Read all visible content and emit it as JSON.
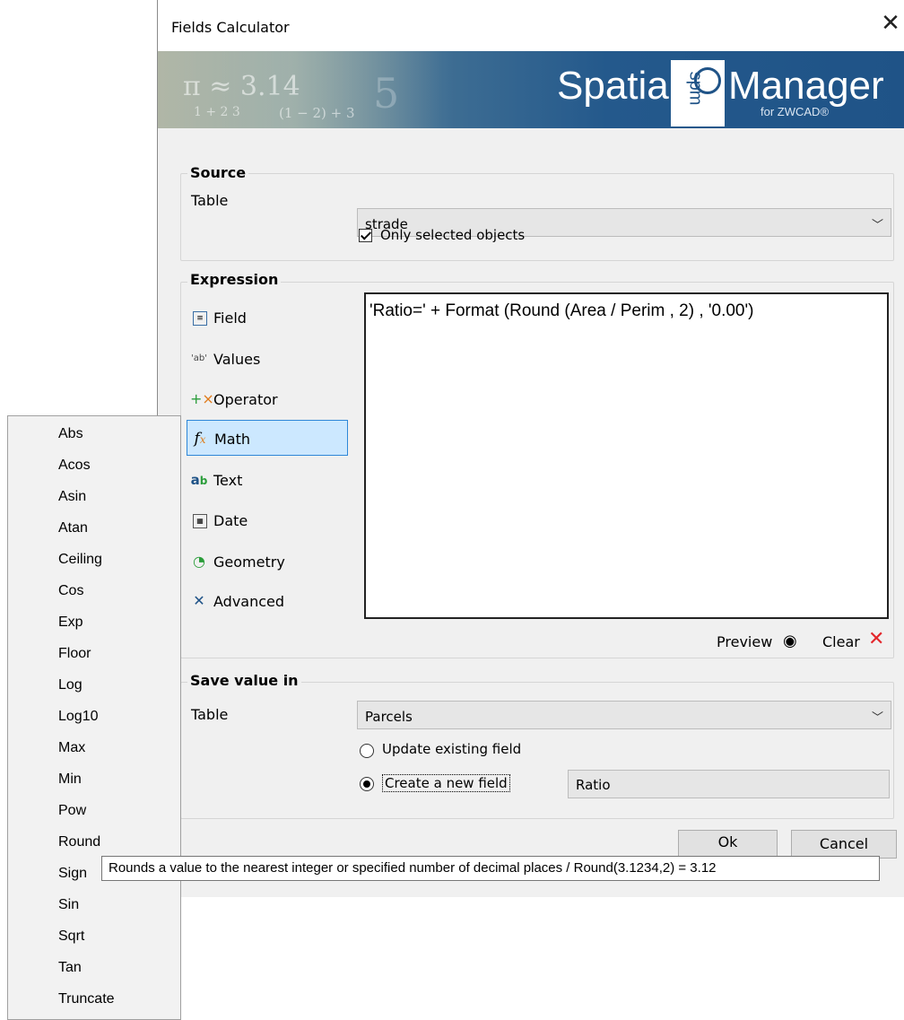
{
  "window": {
    "title": "Fields Calculator"
  },
  "banner": {
    "brand_left": "Spatial",
    "brand_right": "Manager",
    "brand_sub": "for ZWCAD®",
    "logo_text": "spm",
    "math_pi": "π ≈ 3.14",
    "math_frac": "1 + 2 3",
    "math_expr": "(1 − 2) + 3",
    "math_num": "5"
  },
  "source": {
    "legend": "Source",
    "table_label": "Table",
    "table_value": "strade",
    "only_selected_label": "Only selected objects",
    "only_selected_checked": true
  },
  "expression": {
    "legend": "Expression",
    "categories": [
      {
        "label": "Field",
        "icon": "field-icon"
      },
      {
        "label": "Values",
        "icon": "values-icon"
      },
      {
        "label": "Operator",
        "icon": "operator-icon"
      },
      {
        "label": "Math",
        "icon": "math-icon",
        "selected": true
      },
      {
        "label": "Text",
        "icon": "text-icon"
      },
      {
        "label": "Date",
        "icon": "date-icon"
      },
      {
        "label": "Geometry",
        "icon": "geometry-icon"
      },
      {
        "label": "Advanced",
        "icon": "advanced-icon"
      }
    ],
    "text": "'Ratio=' + Format (Round (Area / Perim , 2) , '0.00')",
    "preview_label": "Preview",
    "clear_label": "Clear"
  },
  "save": {
    "legend": "Save value in",
    "table_label": "Table",
    "table_value": "Parcels",
    "update_label": "Update existing field",
    "create_label": "Create a new field",
    "selected_option": "create",
    "new_field_value": "Ratio"
  },
  "buttons": {
    "ok": "Ok",
    "cancel": "Cancel"
  },
  "menu": {
    "items": [
      "Abs",
      "Acos",
      "Asin",
      "Atan",
      "Ceiling",
      "Cos",
      "Exp",
      "Floor",
      "Log",
      "Log10",
      "Max",
      "Min",
      "Pow",
      "Round",
      "Sign",
      "Sin",
      "Sqrt",
      "Tan",
      "Truncate"
    ]
  },
  "tooltip": {
    "text": "Rounds a value to the nearest integer or specified number of decimal places / Round(3.1234,2) = 3.12"
  },
  "colors": {
    "banner_blue": "#1f5387",
    "selection_bg": "#cce8ff",
    "selection_border": "#2e87d8",
    "clear_red": "#e3262b",
    "dialog_bg": "#f0f0f0"
  }
}
